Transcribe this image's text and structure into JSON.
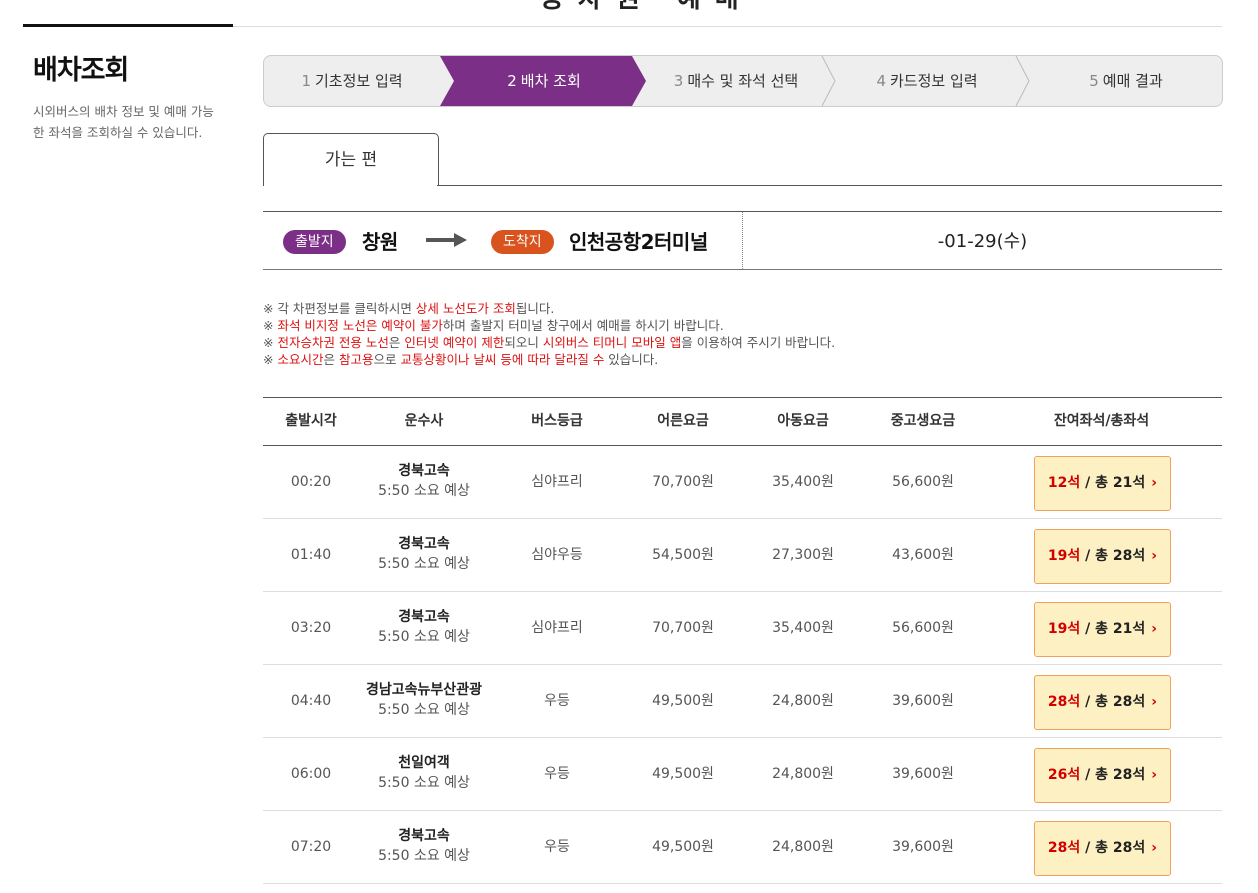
{
  "page": {
    "title_stub": "승차권 예매"
  },
  "sidebar": {
    "title": "배차조회",
    "description": "시외버스의 배차 정보 및 예매 가능한 좌석을 조회하실 수 있습니다."
  },
  "steps": [
    {
      "num": "1",
      "label": "기초정보 입력"
    },
    {
      "num": "2",
      "label": "배차 조회"
    },
    {
      "num": "3",
      "label": "매수 및 좌석 선택"
    },
    {
      "num": "4",
      "label": "카드정보 입력"
    },
    {
      "num": "5",
      "label": "예매 결과"
    }
  ],
  "tab": {
    "label": "가는 편"
  },
  "route": {
    "dep_badge": "출발지",
    "dep_city": "창원",
    "arr_badge": "도착지",
    "arr_city": "인천공항2터미널",
    "date": "-01-29(수)",
    "colors": {
      "dep": "#7b2f86",
      "arr": "#d9531e"
    }
  },
  "notes": [
    [
      {
        "t": "※ 각 차편정보를 클릭하시면 ",
        "r": false
      },
      {
        "t": "상세 노선도가 조회",
        "r": true
      },
      {
        "t": "됩니다.",
        "r": false
      }
    ],
    [
      {
        "t": "※ ",
        "r": false
      },
      {
        "t": "좌석 비지정 노선은 예약이 불가",
        "r": true
      },
      {
        "t": "하며 출발지 터미널 창구에서 예매를 하시기 바랍니다.",
        "r": false
      }
    ],
    [
      {
        "t": "※ ",
        "r": false
      },
      {
        "t": "전자승차권 전용 노선",
        "r": true
      },
      {
        "t": "은 ",
        "r": false
      },
      {
        "t": "인터넷 예약이 제한",
        "r": true
      },
      {
        "t": "되오니 ",
        "r": false
      },
      {
        "t": "시외버스 티머니 모바일 앱",
        "r": true
      },
      {
        "t": "을 이용하여 주시기 바랍니다.",
        "r": false
      }
    ],
    [
      {
        "t": "※ ",
        "r": false
      },
      {
        "t": "소요시간",
        "r": true
      },
      {
        "t": "은 ",
        "r": false
      },
      {
        "t": "참고용",
        "r": true
      },
      {
        "t": "으로 ",
        "r": false
      },
      {
        "t": "교통상황이나 날씨 등에 따라 달라질 수",
        "r": true
      },
      {
        "t": " 있습니다.",
        "r": false
      }
    ]
  ],
  "table": {
    "headers": [
      "출발시각",
      "운수사",
      "버스등급",
      "어른요금",
      "아동요금",
      "중고생요금",
      "잔여좌석/총좌석"
    ],
    "rows": [
      {
        "time": "00:20",
        "company": "경북고속",
        "duration": "5:50 소요 예상",
        "grade": "심야프리",
        "adult": "70,700원",
        "child": "35,400원",
        "student": "56,600원",
        "remaining": "12석",
        "total": "/ 총 21석"
      },
      {
        "time": "01:40",
        "company": "경북고속",
        "duration": "5:50 소요 예상",
        "grade": "심야우등",
        "adult": "54,500원",
        "child": "27,300원",
        "student": "43,600원",
        "remaining": "19석",
        "total": "/ 총 28석"
      },
      {
        "time": "03:20",
        "company": "경북고속",
        "duration": "5:50 소요 예상",
        "grade": "심야프리",
        "adult": "70,700원",
        "child": "35,400원",
        "student": "56,600원",
        "remaining": "19석",
        "total": "/ 총 21석"
      },
      {
        "time": "04:40",
        "company": "경남고속뉴부산관광",
        "duration": "5:50 소요 예상",
        "grade": "우등",
        "adult": "49,500원",
        "child": "24,800원",
        "student": "39,600원",
        "remaining": "28석",
        "total": "/ 총 28석"
      },
      {
        "time": "06:00",
        "company": "천일여객",
        "duration": "5:50 소요 예상",
        "grade": "우등",
        "adult": "49,500원",
        "child": "24,800원",
        "student": "39,600원",
        "remaining": "26석",
        "total": "/ 총 28석"
      },
      {
        "time": "07:20",
        "company": "경북고속",
        "duration": "5:50 소요 예상",
        "grade": "우등",
        "adult": "49,500원",
        "child": "24,800원",
        "student": "39,600원",
        "remaining": "28석",
        "total": "/ 총 28석"
      }
    ]
  },
  "icons": {
    "route_arrow": "arrow-right-icon",
    "seat_chevron": "chevron-right-icon"
  },
  "colors": {
    "accent": "#7b2f86",
    "active_step": "#7b2f86",
    "seat_btn_bg": "#fdf1c3",
    "seat_btn_border": "#f0a15c",
    "red": "#d30000"
  }
}
